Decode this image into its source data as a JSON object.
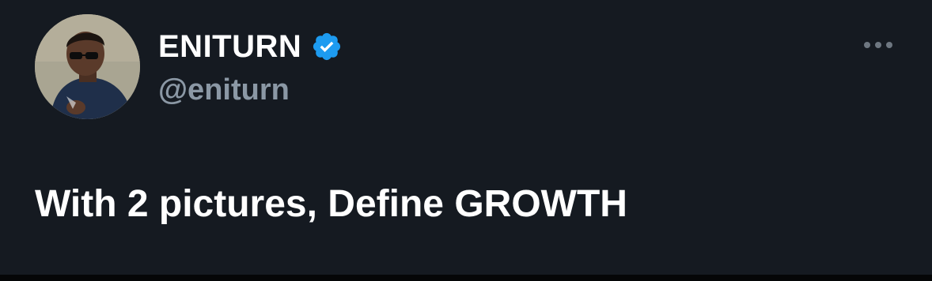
{
  "author": {
    "display_name": "ENITURN",
    "handle": "@eniturn",
    "verified": true,
    "avatar_icon": "profile-photo"
  },
  "tweet": {
    "text": "With 2 pictures, Define GROWTH"
  },
  "actions": {
    "more_icon": "more-horizontal-icon"
  },
  "colors": {
    "background": "#151a21",
    "text_primary": "#ffffff",
    "text_secondary": "#8b98a5",
    "verified_badge": "#1d9bf0"
  }
}
